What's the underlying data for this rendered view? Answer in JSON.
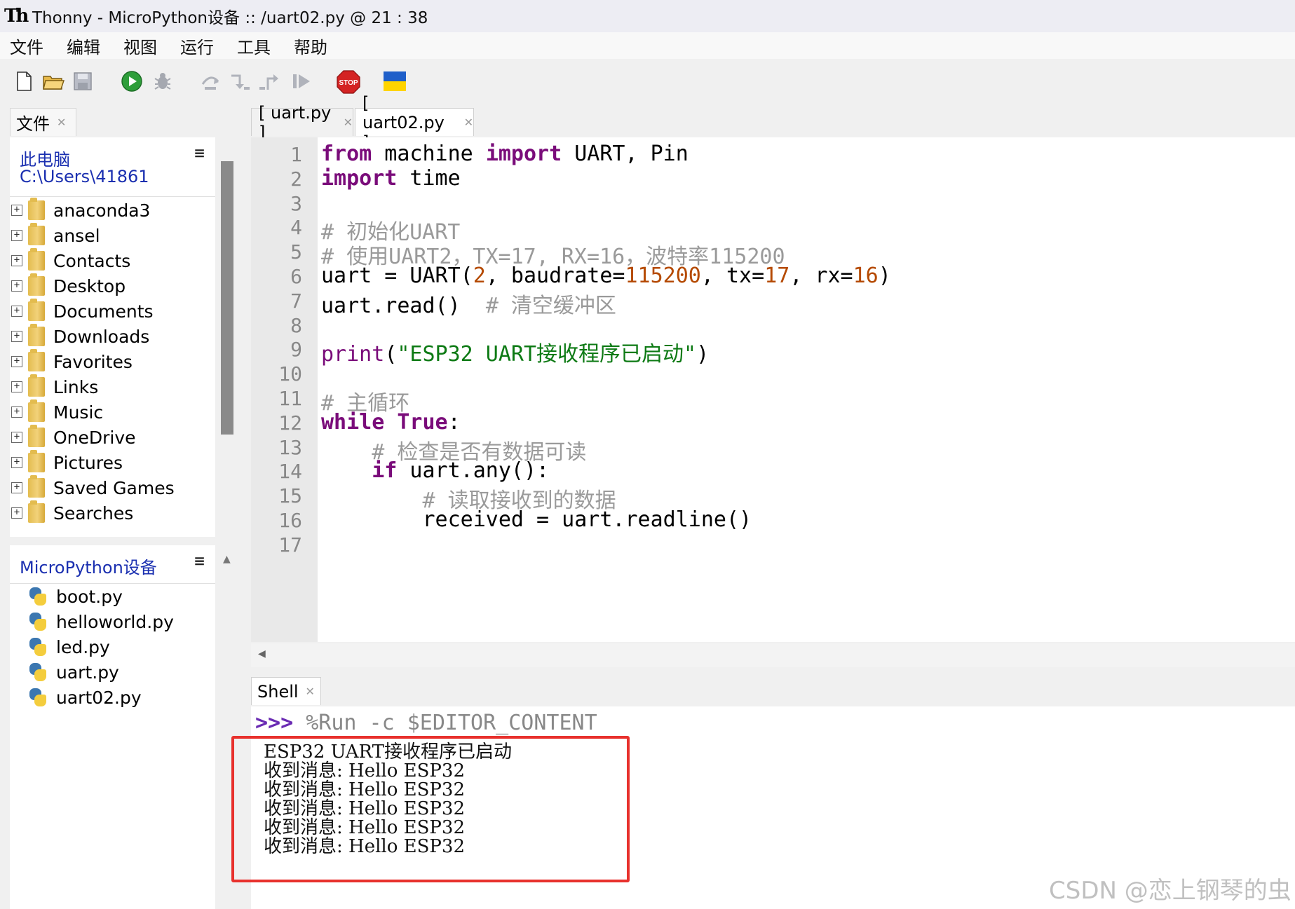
{
  "window": {
    "title": "Thonny  -  MicroPython设备 :: /uart02.py  @  21 : 38",
    "logo": "Th"
  },
  "menu": [
    "文件",
    "编辑",
    "视图",
    "运行",
    "工具",
    "帮助"
  ],
  "toolbar": {
    "icons": [
      "new-file-icon",
      "open-file-icon",
      "save-icon",
      "run-icon",
      "debug-icon",
      "step-over-icon",
      "step-into-icon",
      "step-out-icon",
      "resume-icon",
      "stop-icon",
      "ukraine-flag-icon"
    ],
    "stop_label": "STOP",
    "colors": {
      "run": "#2e9e3a",
      "stop": "#d42323",
      "flag_blue": "#1f5fc9",
      "flag_yellow": "#ffd400"
    }
  },
  "files_panel": {
    "tab_label": "文件",
    "location_title": "此电脑",
    "location_path": "C:\\Users\\41861",
    "menu_glyph": "≡",
    "folders": [
      "anaconda3",
      "ansel",
      "Contacts",
      "Desktop",
      "Documents",
      "Downloads",
      "Favorites",
      "Links",
      "Music",
      "OneDrive",
      "Pictures",
      "Saved Games",
      "Searches"
    ]
  },
  "device_panel": {
    "title": "MicroPython设备",
    "menu_glyph": "≡",
    "files": [
      "boot.py",
      "helloworld.py",
      "led.py",
      "uart.py",
      "uart02.py"
    ]
  },
  "editor": {
    "tabs": [
      {
        "label": "[ uart.py ]",
        "active": false
      },
      {
        "label": "[ uart02.py ]",
        "active": true
      }
    ],
    "line_numbers": [
      "1",
      "2",
      "3",
      "4",
      "5",
      "6",
      "7",
      "8",
      "9",
      "10",
      "11",
      "12",
      "13",
      "14",
      "15",
      "16",
      "17"
    ],
    "lines": [
      [
        {
          "t": "from",
          "c": "kw"
        },
        {
          "t": " machine ",
          "c": ""
        },
        {
          "t": "import",
          "c": "kw"
        },
        {
          "t": " UART, Pin",
          "c": ""
        }
      ],
      [
        {
          "t": "import",
          "c": "kw"
        },
        {
          "t": " time",
          "c": ""
        }
      ],
      [],
      [
        {
          "t": "# 初始化UART",
          "c": "cm"
        }
      ],
      [
        {
          "t": "# 使用UART2，TX=17, RX=16，波特率115200",
          "c": "cm"
        }
      ],
      [
        {
          "t": "uart = UART(",
          "c": ""
        },
        {
          "t": "2",
          "c": "num"
        },
        {
          "t": ", baudrate=",
          "c": ""
        },
        {
          "t": "115200",
          "c": "num"
        },
        {
          "t": ", tx=",
          "c": ""
        },
        {
          "t": "17",
          "c": "num"
        },
        {
          "t": ", rx=",
          "c": ""
        },
        {
          "t": "16",
          "c": "num"
        },
        {
          "t": ")",
          "c": ""
        }
      ],
      [
        {
          "t": "uart.read()  ",
          "c": ""
        },
        {
          "t": "# 清空缓冲区",
          "c": "cm"
        }
      ],
      [],
      [
        {
          "t": "print",
          "c": "fn"
        },
        {
          "t": "(",
          "c": ""
        },
        {
          "t": "\"ESP32 UART接收程序已启动\"",
          "c": "str"
        },
        {
          "t": ")",
          "c": ""
        }
      ],
      [],
      [
        {
          "t": "# 主循环",
          "c": "cm"
        }
      ],
      [
        {
          "t": "while",
          "c": "kw"
        },
        {
          "t": " ",
          "c": ""
        },
        {
          "t": "True",
          "c": "kw"
        },
        {
          "t": ":",
          "c": ""
        }
      ],
      [
        {
          "t": "    ",
          "c": ""
        },
        {
          "t": "# 检查是否有数据可读",
          "c": "cm"
        }
      ],
      [
        {
          "t": "    ",
          "c": ""
        },
        {
          "t": "if",
          "c": "kw"
        },
        {
          "t": " uart.any():",
          "c": ""
        }
      ],
      [
        {
          "t": "        ",
          "c": ""
        },
        {
          "t": "# 读取接收到的数据",
          "c": "cm"
        }
      ],
      [
        {
          "t": "        received = uart.readline()",
          "c": ""
        }
      ],
      []
    ]
  },
  "shell": {
    "tab_label": "Shell",
    "prompt": ">>>",
    "command": " %Run -c $EDITOR_CONTENT",
    "output": [
      "ESP32 UART接收程序已启动",
      "收到消息: Hello ESP32",
      "收到消息: Hello ESP32",
      "收到消息: Hello ESP32",
      "收到消息: Hello ESP32",
      "收到消息: Hello ESP32"
    ],
    "highlight_color": "#e8312d"
  },
  "watermark": "CSDN @恋上钢琴的虫"
}
